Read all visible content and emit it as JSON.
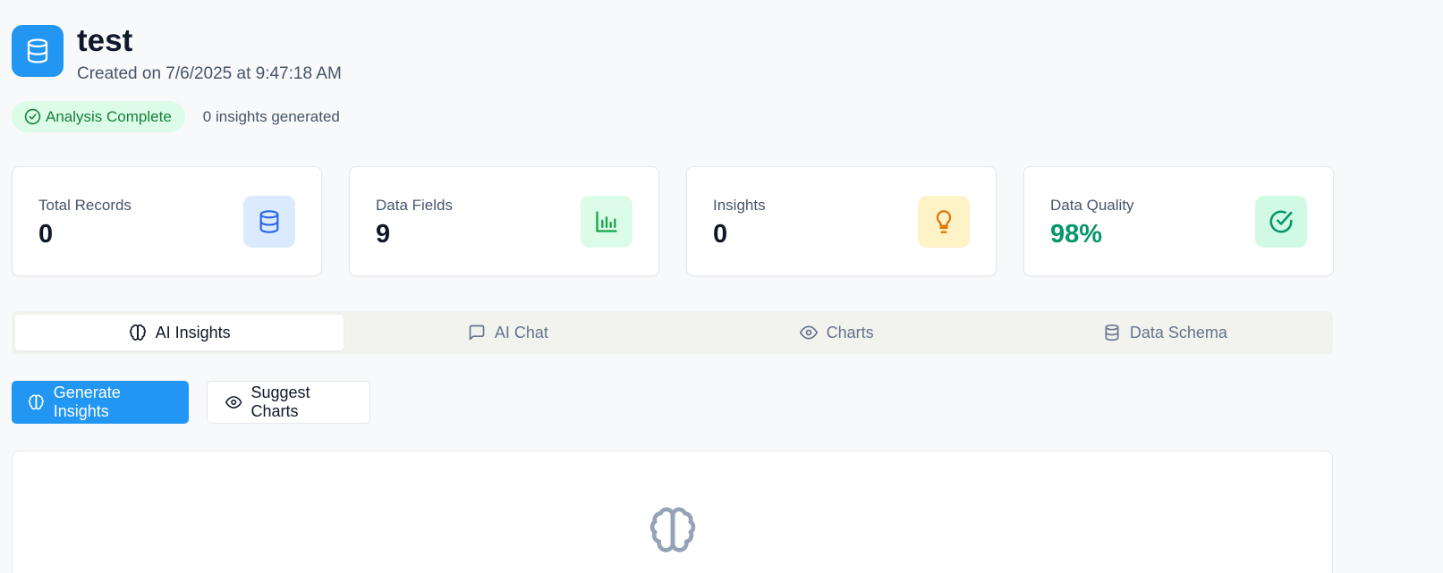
{
  "header": {
    "title": "test",
    "subtitle": "Created on 7/6/2025 at 9:47:18 AM",
    "icon": "database-icon"
  },
  "status": {
    "badge_label": "Analysis Complete",
    "insights_generated": "0 insights generated"
  },
  "stats": [
    {
      "label": "Total Records",
      "value": "0",
      "icon": "database-icon",
      "icon_bg": "#dbeafe",
      "icon_color": "#2563eb"
    },
    {
      "label": "Data Fields",
      "value": "9",
      "icon": "bar-chart-icon",
      "icon_bg": "#dcfce7",
      "icon_color": "#16a34a"
    },
    {
      "label": "Insights",
      "value": "0",
      "icon": "lightbulb-icon",
      "icon_bg": "#fef3c7",
      "icon_color": "#d97706"
    },
    {
      "label": "Data Quality",
      "value": "98%",
      "icon": "check-circle-icon",
      "icon_bg": "#d1fae5",
      "icon_color": "#059669"
    }
  ],
  "tabs": [
    {
      "label": "AI Insights",
      "icon": "brain-icon",
      "active": true
    },
    {
      "label": "AI Chat",
      "icon": "message-square-icon",
      "active": false
    },
    {
      "label": "Charts",
      "icon": "eye-icon",
      "active": false
    },
    {
      "label": "Data Schema",
      "icon": "database-icon",
      "active": false
    }
  ],
  "actions": {
    "generate_label": "Generate Insights",
    "suggest_label": "Suggest Charts"
  },
  "colors": {
    "accent": "#2196f3",
    "success": "#15803d",
    "quality": "#059669"
  }
}
